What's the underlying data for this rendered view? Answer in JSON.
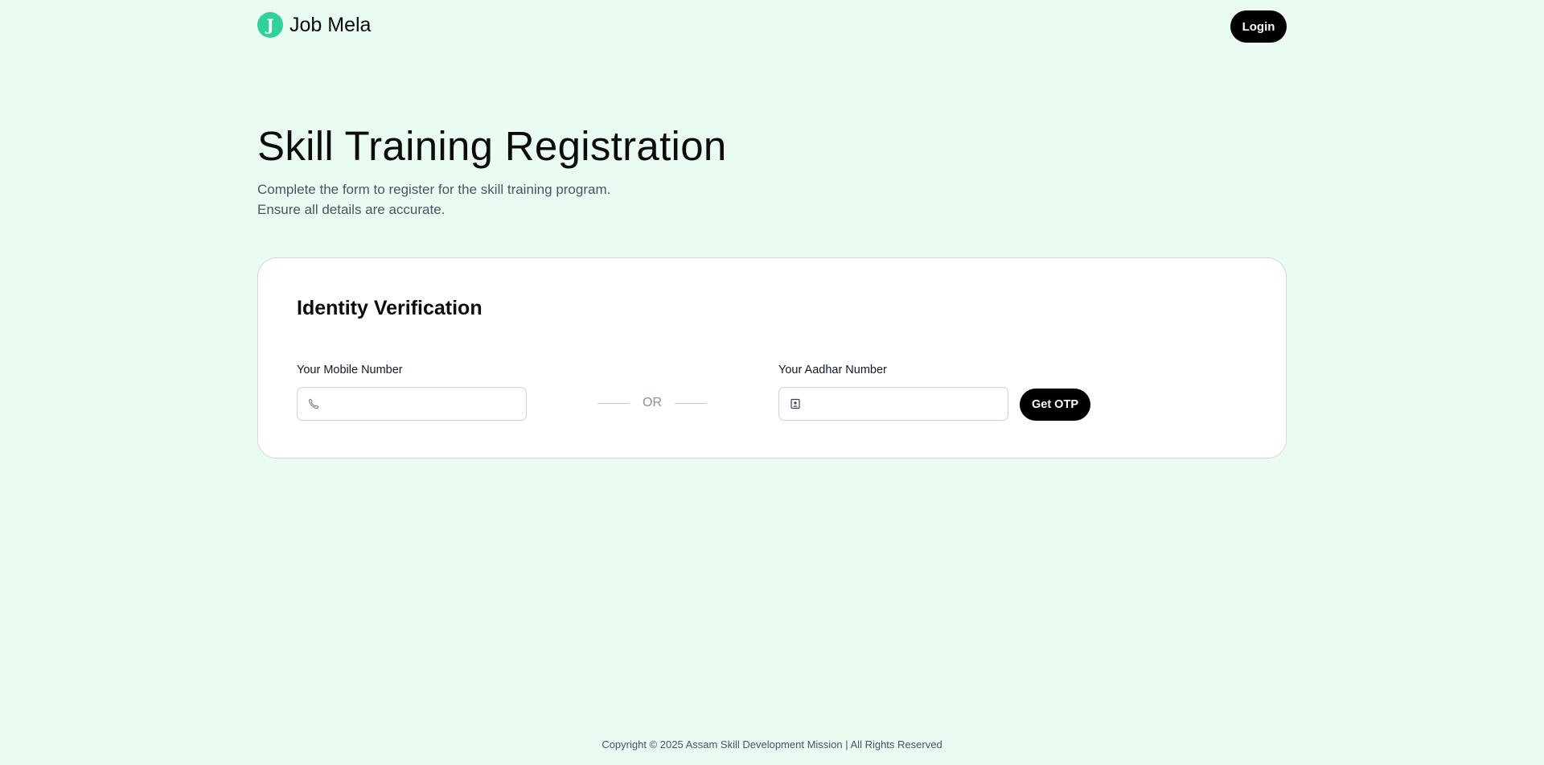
{
  "header": {
    "logo_letter": "J",
    "brand_name": "Job Mela",
    "login_label": "Login"
  },
  "hero": {
    "title": "Skill Training Registration",
    "subtitle_line1": "Complete the form to register for the skill training program.",
    "subtitle_line2": "Ensure all details are accurate."
  },
  "form": {
    "title": "Identity Verification",
    "mobile": {
      "label": "Your Mobile Number",
      "value": "",
      "icon": "phone-icon"
    },
    "separator": "OR",
    "aadhar": {
      "label": "Your Aadhar Number",
      "value": "",
      "icon": "id-card-icon"
    },
    "otp_button": "Get OTP"
  },
  "footer": {
    "copyright": "Copyright © 2025 Assam Skill Development Mission | All Rights Reserved"
  },
  "colors": {
    "background": "#eafcf2",
    "accent": "#2fd39a",
    "button": "#000000",
    "card": "#ffffff"
  }
}
